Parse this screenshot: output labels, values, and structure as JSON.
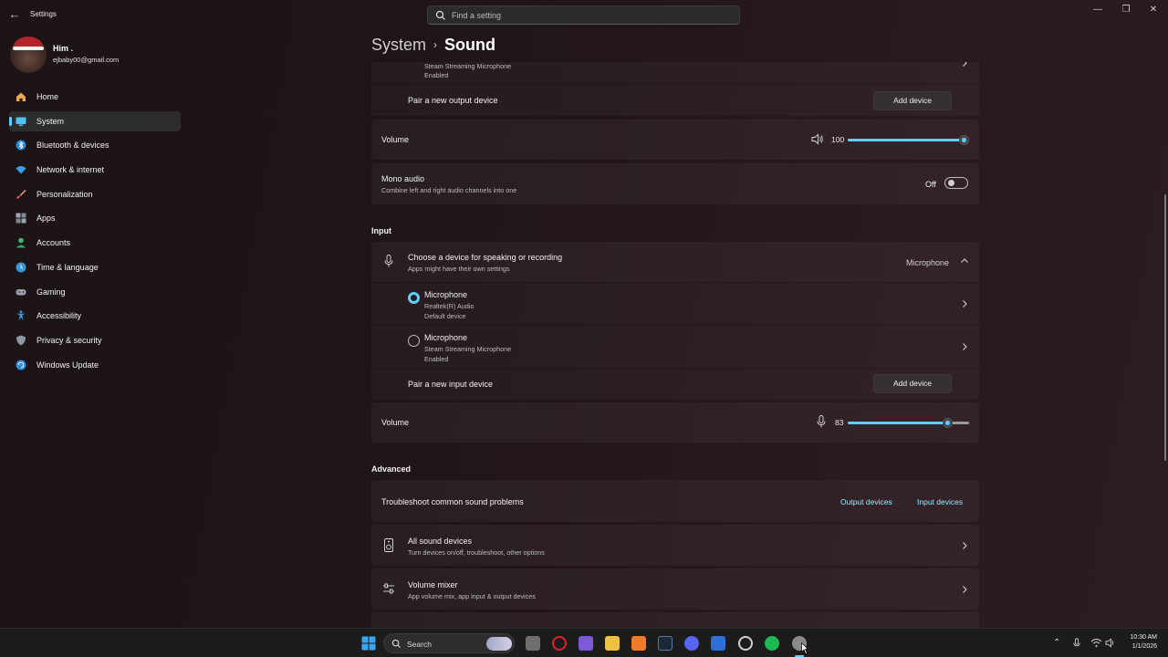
{
  "window": {
    "title": "Settings",
    "search_placeholder": "Find a setting"
  },
  "profile": {
    "name": "Him .",
    "email": "ejbaby00@gmail.com"
  },
  "nav": [
    {
      "label": "Home",
      "icon": "home-icon",
      "active": false
    },
    {
      "label": "System",
      "icon": "monitor-icon",
      "active": true
    },
    {
      "label": "Bluetooth & devices",
      "icon": "bluetooth-icon",
      "active": false
    },
    {
      "label": "Network & internet",
      "icon": "wifi-icon",
      "active": false
    },
    {
      "label": "Personalization",
      "icon": "brush-icon",
      "active": false
    },
    {
      "label": "Apps",
      "icon": "apps-icon",
      "active": false
    },
    {
      "label": "Accounts",
      "icon": "person-icon",
      "active": false
    },
    {
      "label": "Time & language",
      "icon": "globe-clock-icon",
      "active": false
    },
    {
      "label": "Gaming",
      "icon": "gamepad-icon",
      "active": false
    },
    {
      "label": "Accessibility",
      "icon": "accessibility-icon",
      "active": false
    },
    {
      "label": "Privacy & security",
      "icon": "shield-icon",
      "active": false
    },
    {
      "label": "Windows Update",
      "icon": "update-icon",
      "active": false
    }
  ],
  "breadcrumb": {
    "parent": "System",
    "separator": "›",
    "current": "Sound"
  },
  "output": {
    "partial_device": {
      "sub1": "Steam Streaming Microphone",
      "sub2": "Enabled"
    },
    "pair_label": "Pair a new output device",
    "add_button": "Add device",
    "volume_label": "Volume",
    "volume_value": "100",
    "volume_fraction": 1.0,
    "mono_title": "Mono audio",
    "mono_desc": "Combine left and right audio channels into one",
    "mono_state": "Off"
  },
  "input": {
    "section_title": "Input",
    "choose_title": "Choose a device for speaking or recording",
    "choose_desc": "Apps might have their own settings",
    "selected_device": "Microphone",
    "devices": [
      {
        "name": "Microphone",
        "sub1": "Realtek(R) Audio",
        "sub2": "Default device",
        "selected": true
      },
      {
        "name": "Microphone",
        "sub1": "Steam Streaming Microphone",
        "sub2": "Enabled",
        "selected": false
      }
    ],
    "pair_label": "Pair a new input device",
    "add_button": "Add device",
    "volume_label": "Volume",
    "volume_value": "83",
    "volume_fraction": 0.83
  },
  "advanced": {
    "section_title": "Advanced",
    "troubleshoot_label": "Troubleshoot common sound problems",
    "output_link": "Output devices",
    "input_link": "Input devices",
    "all_devices_title": "All sound devices",
    "all_devices_desc": "Turn devices on/off, troubleshoot, other options",
    "mixer_title": "Volume mixer",
    "mixer_desc": "App volume mix, app input & output devices"
  },
  "taskbar": {
    "search_label": "Search",
    "time": "10:30 AM",
    "date": "1/1/2026"
  },
  "colors": {
    "accent": "#60cdff",
    "link": "#99ebff"
  }
}
